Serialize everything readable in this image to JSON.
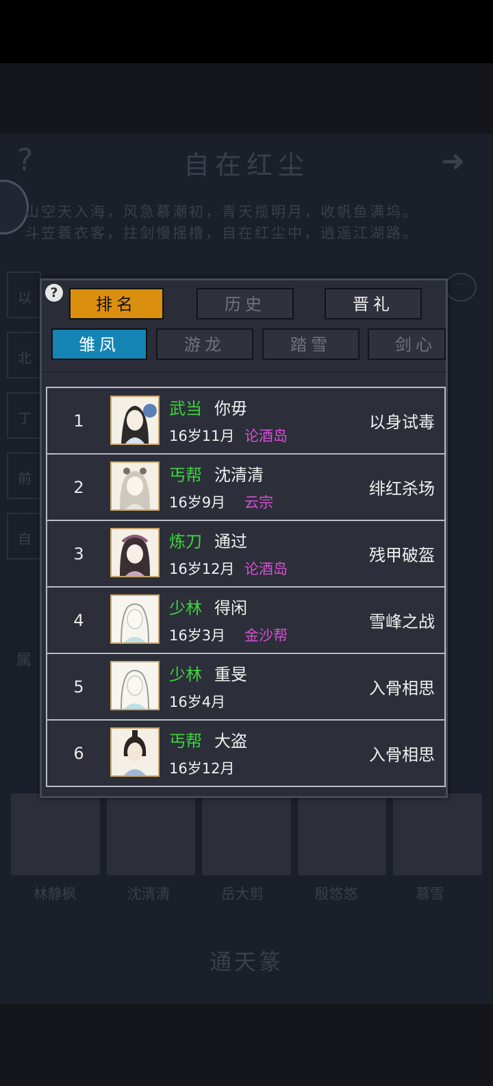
{
  "background": {
    "title": "自在红尘",
    "poem_line_1": "山空天入海，风急慕潮初，青天揽明月，收帆鱼满坞。",
    "poem_line_2": "斗笠蓑衣客，拄剑慢摇橹，自在红尘中，逍遥江湖路。",
    "side_rows": [
      "以",
      "北",
      "丁",
      "前",
      "自"
    ],
    "attr_label": "属",
    "heroes": [
      "林静枫",
      "沈清清",
      "岳大剪",
      "殷悠悠",
      "慕雪"
    ],
    "bottom_title": "通天篆"
  },
  "dialog": {
    "help_label": "?",
    "main_tabs": [
      "排名",
      "历史",
      "晋礼"
    ],
    "sub_tabs": [
      "雏凤",
      "游龙",
      "踏雪",
      "剑心"
    ],
    "rows": [
      {
        "rank": "1",
        "sect": "武当",
        "name": "你毋",
        "age": "16岁11月",
        "place": "论酒岛",
        "title": "以身试毒"
      },
      {
        "rank": "2",
        "sect": "丐帮",
        "name": "沈清清",
        "age": "16岁9月",
        "place": "云宗",
        "title": "绯红杀场"
      },
      {
        "rank": "3",
        "sect": "炼刀",
        "name": "通过",
        "age": "16岁12月",
        "place": "论酒岛",
        "title": "残甲破盔"
      },
      {
        "rank": "4",
        "sect": "少林",
        "name": "得闲",
        "age": "16岁3月",
        "place": "金沙帮",
        "title": "雪峰之战"
      },
      {
        "rank": "5",
        "sect": "少林",
        "name": "重旻",
        "age": "16岁4月",
        "place": "",
        "title": "入骨相思"
      },
      {
        "rank": "6",
        "sect": "丐帮",
        "name": "大盗",
        "age": "16岁12月",
        "place": "",
        "title": "入骨相思"
      }
    ]
  },
  "colors": {
    "active_tab": "#db8f0f",
    "active_subtab": "#1485b4",
    "sect": "#3fd33f",
    "place": "#d94fd6"
  }
}
